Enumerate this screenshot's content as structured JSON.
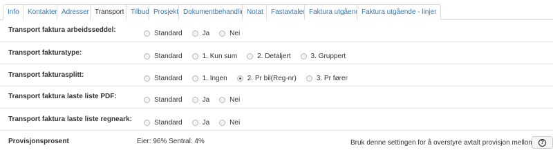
{
  "tabs": [
    {
      "label": "Info",
      "active": false
    },
    {
      "label": "Kontakter",
      "active": false
    },
    {
      "label": "Adresser",
      "active": false
    },
    {
      "label": "Transport",
      "active": true
    },
    {
      "label": "Tilbud",
      "active": false
    },
    {
      "label": "Prosjekt",
      "active": false
    },
    {
      "label": "Dokumentbehandling",
      "active": false
    },
    {
      "label": "Notat",
      "active": false
    },
    {
      "label": "Fastavtaler",
      "active": false
    },
    {
      "label": "Faktura utgående",
      "active": false
    },
    {
      "label": "Faktura utgående - linjer",
      "active": false
    }
  ],
  "settings": [
    {
      "label": "Transport faktura arbeidsseddel:",
      "options": [
        "Standard",
        "Ja",
        "Nei"
      ],
      "selected": null
    },
    {
      "label": "Transport fakturatype:",
      "options": [
        "Standard",
        "1. Kun sum",
        "2. Detaljert",
        "3. Gruppert"
      ],
      "selected": null
    },
    {
      "label": "Transport fakturasplitt:",
      "options": [
        "Standard",
        "1. Ingen",
        "2. Pr bil(Reg-nr)",
        "3. Pr fører"
      ],
      "selected": "2. Pr bil(Reg-nr)"
    },
    {
      "label": "Transport faktura laste liste PDF:",
      "options": [
        "Standard",
        "Ja",
        "Nei"
      ],
      "selected": null
    },
    {
      "label": "Transport faktura laste liste regneark:",
      "options": [
        "Standard",
        "Ja",
        "Nei"
      ],
      "selected": null
    }
  ],
  "provisjon": {
    "label": "Provisjonsprosent",
    "value": "Eier: 96% Sentral: 4%",
    "note": "Bruk denne settingen for å overstyre avtalt provisjon mellom eier og sentral",
    "help_icon": "question-circle-icon"
  }
}
